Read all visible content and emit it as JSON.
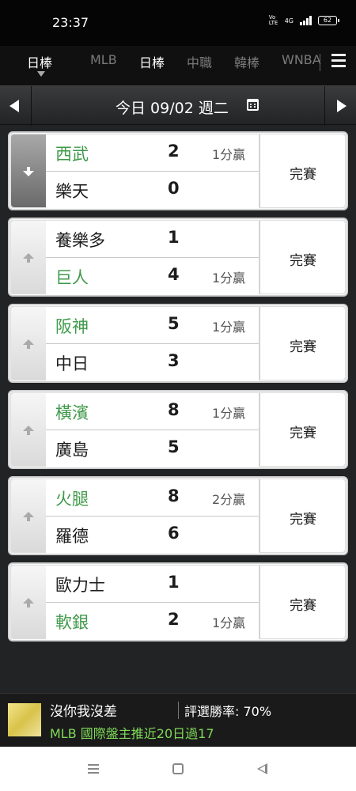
{
  "status_bar": {
    "time": "23:37",
    "network": "Vo LTE",
    "signal": "4G",
    "battery": "62"
  },
  "tabs": {
    "items": [
      {
        "label": "日棒",
        "selected": true
      },
      {
        "label": "MLB"
      },
      {
        "label": "日棒"
      },
      {
        "label": "中職"
      },
      {
        "label": "韓棒"
      },
      {
        "label": "WNBA"
      }
    ]
  },
  "date_bar": {
    "date": "今日 09/02 週二"
  },
  "games": [
    {
      "expanded": true,
      "status": "完賽",
      "top": {
        "name": "西武",
        "score": "2",
        "margin": "1分贏",
        "winner": true
      },
      "bottom": {
        "name": "樂天",
        "score": "0",
        "margin": "",
        "winner": false
      }
    },
    {
      "status": "完賽",
      "top": {
        "name": "養樂多",
        "score": "1",
        "margin": "",
        "winner": false
      },
      "bottom": {
        "name": "巨人",
        "score": "4",
        "margin": "1分贏",
        "winner": true
      }
    },
    {
      "status": "完賽",
      "top": {
        "name": "阪神",
        "score": "5",
        "margin": "1分贏",
        "winner": true
      },
      "bottom": {
        "name": "中日",
        "score": "3",
        "margin": "",
        "winner": false
      }
    },
    {
      "status": "完賽",
      "top": {
        "name": "橫濱",
        "score": "8",
        "margin": "1分贏",
        "winner": true
      },
      "bottom": {
        "name": "廣島",
        "score": "5",
        "margin": "",
        "winner": false
      }
    },
    {
      "status": "完賽",
      "top": {
        "name": "火腿",
        "score": "8",
        "margin": "2分贏",
        "winner": true
      },
      "bottom": {
        "name": "羅德",
        "score": "6",
        "margin": "",
        "winner": false
      }
    },
    {
      "status": "完賽",
      "top": {
        "name": "歐力士",
        "score": "1",
        "margin": "",
        "winner": false
      },
      "bottom": {
        "name": "軟銀",
        "score": "2",
        "margin": "1分贏",
        "winner": true
      }
    }
  ],
  "ad": {
    "title": "沒你我沒差",
    "rate": "評選勝率: 70%",
    "subtitle": "MLB 國際盤主推近20日過17"
  },
  "colors": {
    "winner_green": "#3f9a4a",
    "ad_green": "#7ed957",
    "background": "#222324"
  }
}
